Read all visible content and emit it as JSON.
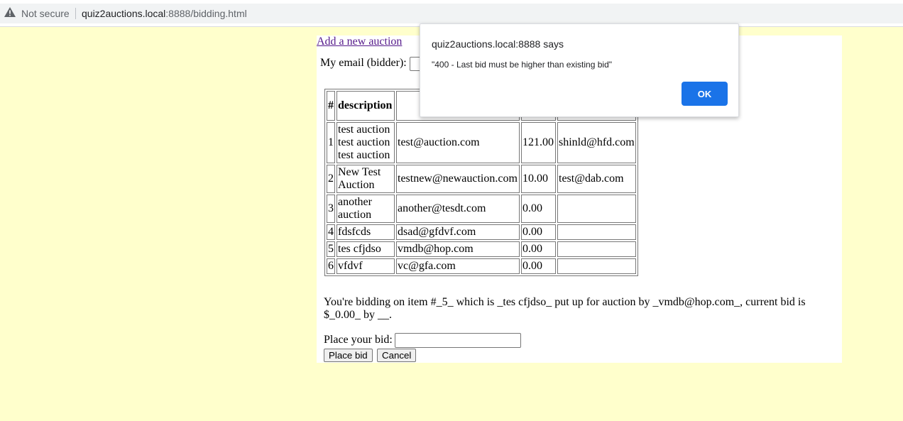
{
  "browser": {
    "security_label": "Not secure",
    "url_host": "quiz2auctions.local",
    "url_path": ":8888/bidding.html"
  },
  "page": {
    "add_link": "Add a new auction",
    "email_label": "My email (bidder):",
    "email_value": "",
    "table": {
      "headers": [
        "#",
        "description",
        "",
        "",
        ""
      ],
      "rows": [
        [
          "1",
          "test auction test auction test auction",
          "test@auction.com",
          "121.00",
          "shinld@hfd.com"
        ],
        [
          "2",
          "New Test Auction",
          "testnew@newauction.com",
          "10.00",
          "test@dab.com"
        ],
        [
          "3",
          "another auction",
          "another@tesdt.com",
          "0.00",
          ""
        ],
        [
          "4",
          "fdsfcds",
          "dsad@gfdvf.com",
          "0.00",
          ""
        ],
        [
          "5",
          "tes cfjdso",
          "vmdb@hop.com",
          "0.00",
          ""
        ],
        [
          "6",
          "vfdvf",
          "vc@gfa.com",
          "0.00",
          ""
        ]
      ]
    },
    "bidding_text": "You're bidding on item #_5_ which is _tes cfjdso_ put up for auction by _vmdb@hop.com_, current bid is $_0.00_ by __.",
    "bid_label": "Place your bid:",
    "bid_value": "",
    "place_bid_button": "Place bid",
    "cancel_button": "Cancel"
  },
  "dialog": {
    "title": "quiz2auctions.local:8888 says",
    "message": "\"400 - Last bid must be higher than existing bid\"",
    "ok_label": "OK"
  }
}
